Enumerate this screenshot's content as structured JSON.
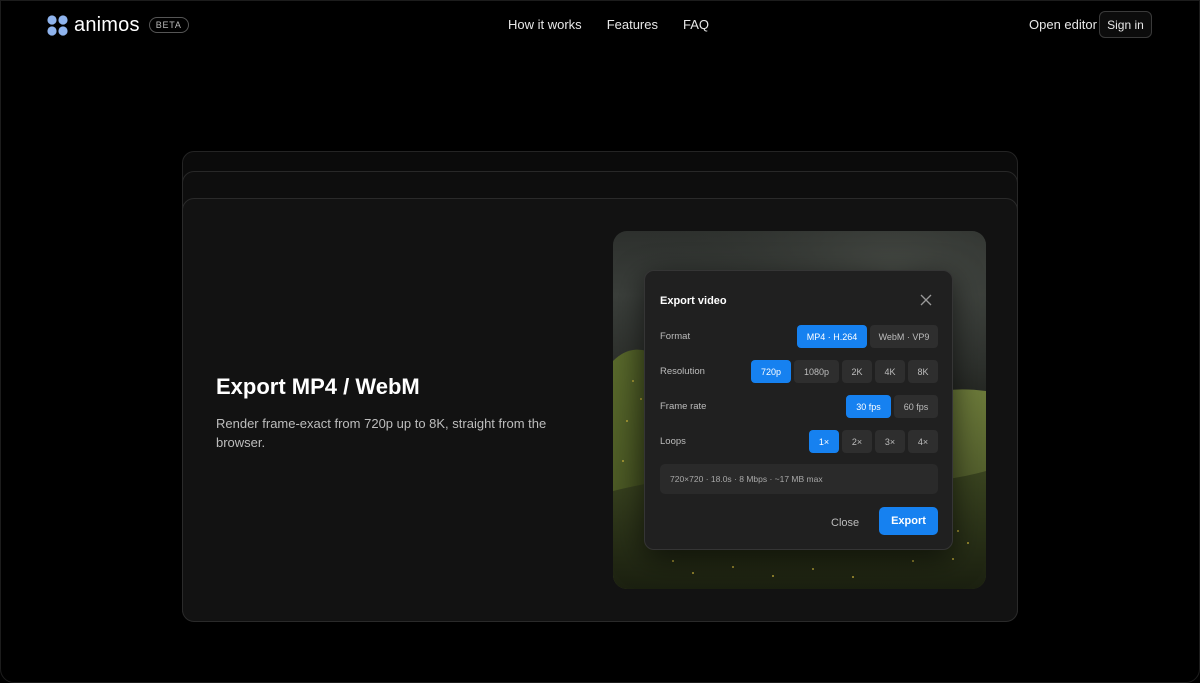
{
  "header": {
    "logo_text": "animos",
    "beta": "BETA",
    "nav": [
      "How it works",
      "Features",
      "FAQ"
    ],
    "open_editor": "Open editor",
    "sign_in": "Sign in"
  },
  "feature": {
    "title": "Export MP4 / WebM",
    "description": "Render frame-exact from 720p up to 8K, straight from the browser."
  },
  "dialog": {
    "title": "Export video",
    "rows": [
      {
        "label": "Format",
        "options": [
          "MP4 · H.264",
          "WebM · VP9"
        ],
        "selected": "MP4 · H.264"
      },
      {
        "label": "Resolution",
        "options": [
          "720p",
          "1080p",
          "2K",
          "4K",
          "8K"
        ],
        "selected": "720p"
      },
      {
        "label": "Frame rate",
        "options": [
          "30 fps",
          "60 fps"
        ],
        "selected": "30 fps"
      },
      {
        "label": "Loops",
        "options": [
          "1×",
          "2×",
          "3×",
          "4×"
        ],
        "selected": "1×"
      }
    ],
    "summary": "720×720 · 18.0s · 8 Mbps · ~17 MB max",
    "close_label": "Close",
    "export_label": "Export"
  },
  "colors": {
    "accent": "#1681f0",
    "logo": "#8fb4ee",
    "background": "#000000",
    "card": "#121212"
  }
}
